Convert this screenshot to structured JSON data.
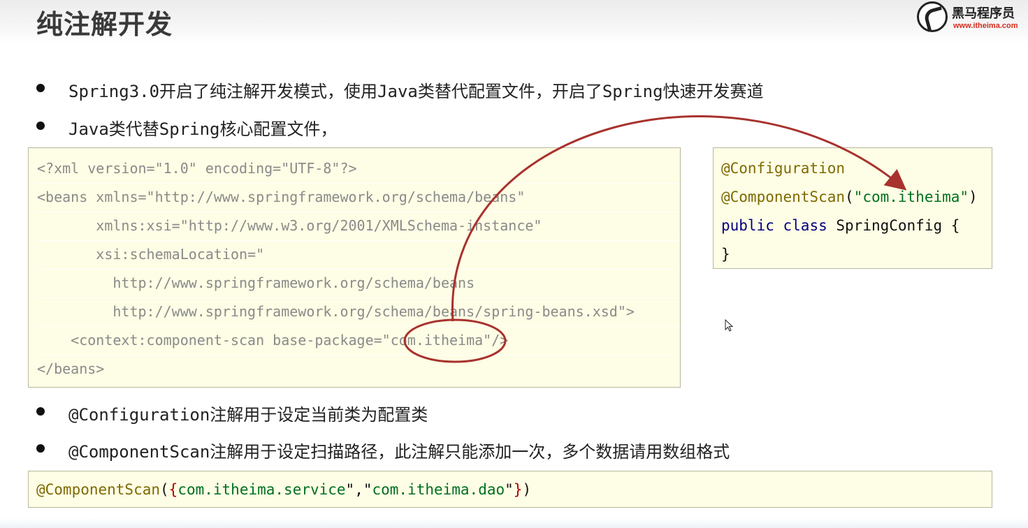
{
  "header": {
    "title": "纯注解开发",
    "logo_name": "黑马程序员",
    "logo_url": "www.itheima.com"
  },
  "bullets": [
    "Spring3.0开启了纯注解开发模式，使用Java类替代配置文件，开启了Spring快速开发赛道",
    "Java类代替Spring核心配置文件，",
    "@Configuration注解用于设定当前类为配置类",
    "@ComponentScan注解用于设定扫描路径，此注解只能添加一次，多个数据请用数组格式"
  ],
  "xml_code": {
    "lines": [
      "<?xml version=\"1.0\" encoding=\"UTF-8\"?>",
      "<beans xmlns=\"http://www.springframework.org/schema/beans\"",
      "       xmlns:xsi=\"http://www.w3.org/2001/XMLSchema-instance\"",
      "       xsi:schemaLocation=\"",
      "         http://www.springframework.org/schema/beans",
      "         http://www.springframework.org/schema/beans/spring-beans.xsd\">",
      "    <context:component-scan base-package=\"com.itheima\"/>",
      "</beans>"
    ]
  },
  "java_code": {
    "annotation_configuration": "@Configuration",
    "annotation_componentscan": "@ComponentScan",
    "open_paren": "(",
    "scan_value": "\"com.itheima\"",
    "close_paren": ")",
    "kw_public": "public",
    "kw_class": "class",
    "class_decl": "SpringConfig {",
    "close_brace": "}"
  },
  "bottom_code": {
    "annotation": "@ComponentScan",
    "open": "(",
    "brace_open": "{",
    "value1": "com.itheima.service",
    "quote_sep": "\",\"",
    "value2": "com.itheima.dao",
    "quote_end": "\"",
    "brace_close": "}",
    "close": ")"
  },
  "colors": {
    "code_bg": "#fefde5",
    "annotation": "#7d6a00",
    "keyword": "#000080",
    "string": "#007020",
    "arrow": "#a8322d",
    "logo_url": "#d52b1e"
  },
  "icons": [
    "logo-horse-icon",
    "bullet-dot-icon",
    "mouse-cursor-icon",
    "curved-arrow-icon"
  ]
}
